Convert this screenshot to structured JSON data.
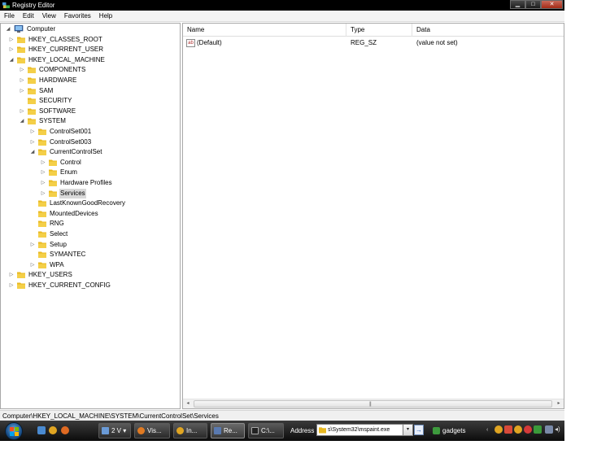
{
  "window": {
    "title": "Registry Editor",
    "minimize": "▁",
    "maximize": "□",
    "close": "✕"
  },
  "menu": [
    "File",
    "Edit",
    "View",
    "Favorites",
    "Help"
  ],
  "tree": [
    {
      "label": "Computer",
      "level": 0,
      "expander": "◢",
      "icon": "computer-icon"
    },
    {
      "label": "HKEY_CLASSES_ROOT",
      "level": 1,
      "expander": "▷",
      "icon": "folder-icon"
    },
    {
      "label": "HKEY_CURRENT_USER",
      "level": 1,
      "expander": "▷",
      "icon": "folder-icon"
    },
    {
      "label": "HKEY_LOCAL_MACHINE",
      "level": 1,
      "expander": "◢",
      "icon": "folder-icon"
    },
    {
      "label": "COMPONENTS",
      "level": 2,
      "expander": "▷",
      "icon": "folder-icon"
    },
    {
      "label": "HARDWARE",
      "level": 2,
      "expander": "▷",
      "icon": "folder-icon"
    },
    {
      "label": "SAM",
      "level": 2,
      "expander": "▷",
      "icon": "folder-icon"
    },
    {
      "label": "SECURITY",
      "level": 2,
      "expander": "",
      "icon": "folder-icon"
    },
    {
      "label": "SOFTWARE",
      "level": 2,
      "expander": "▷",
      "icon": "folder-icon"
    },
    {
      "label": "SYSTEM",
      "level": 2,
      "expander": "◢",
      "icon": "folder-icon"
    },
    {
      "label": "ControlSet001",
      "level": 3,
      "expander": "▷",
      "icon": "folder-icon"
    },
    {
      "label": "ControlSet003",
      "level": 3,
      "expander": "▷",
      "icon": "folder-icon"
    },
    {
      "label": "CurrentControlSet",
      "level": 3,
      "expander": "◢",
      "icon": "folder-icon"
    },
    {
      "label": "Control",
      "level": 4,
      "expander": "▷",
      "icon": "folder-icon"
    },
    {
      "label": "Enum",
      "level": 4,
      "expander": "▷",
      "icon": "folder-icon"
    },
    {
      "label": "Hardware Profiles",
      "level": 4,
      "expander": "▷",
      "icon": "folder-icon"
    },
    {
      "label": "Services",
      "level": 4,
      "expander": "▷",
      "icon": "folder-icon",
      "selected": true
    },
    {
      "label": "LastKnownGoodRecovery",
      "level": 3,
      "expander": "",
      "icon": "folder-icon"
    },
    {
      "label": "MountedDevices",
      "level": 3,
      "expander": "",
      "icon": "folder-icon"
    },
    {
      "label": "RNG",
      "level": 3,
      "expander": "",
      "icon": "folder-icon"
    },
    {
      "label": "Select",
      "level": 3,
      "expander": "",
      "icon": "folder-icon"
    },
    {
      "label": "Setup",
      "level": 3,
      "expander": "▷",
      "icon": "folder-icon"
    },
    {
      "label": "SYMANTEC",
      "level": 3,
      "expander": "",
      "icon": "folder-icon"
    },
    {
      "label": "WPA",
      "level": 3,
      "expander": "▷",
      "icon": "folder-icon"
    },
    {
      "label": "HKEY_USERS",
      "level": 1,
      "expander": "▷",
      "icon": "folder-icon"
    },
    {
      "label": "HKEY_CURRENT_CONFIG",
      "level": 1,
      "expander": "▷",
      "icon": "folder-icon"
    }
  ],
  "list": {
    "columns": [
      "Name",
      "Type",
      "Data"
    ],
    "rows": [
      {
        "icon_text": "ab",
        "name": "(Default)",
        "type": "REG_SZ",
        "data": "(value not set)"
      }
    ]
  },
  "scrollbar": {
    "left": "◂",
    "right": "▸",
    "grip": "|||"
  },
  "status": "Computer\\HKEY_LOCAL_MACHINE\\SYSTEM\\CurrentControlSet\\Services",
  "taskbar": {
    "buttons": [
      {
        "label": "2 V",
        "suffix": "▾",
        "icon_color": "#6a9ad6"
      },
      {
        "label": "Vis...",
        "icon_color": "#e07a22"
      },
      {
        "label": "In...",
        "icon_color": "#e0a522"
      },
      {
        "label": "Re...",
        "icon_color": "#5a7ab0",
        "active": true
      },
      {
        "label": "C:\\...",
        "icon_color": "#222222"
      }
    ],
    "address_label": "Address",
    "address_value": "s\\System32\\mspaint.exe",
    "address_go": "→",
    "address_drop": "▾",
    "gadgets_label": "gadgets",
    "colors": {
      "folder": "#e8b820",
      "taskbar": "#1e1e1e"
    }
  }
}
